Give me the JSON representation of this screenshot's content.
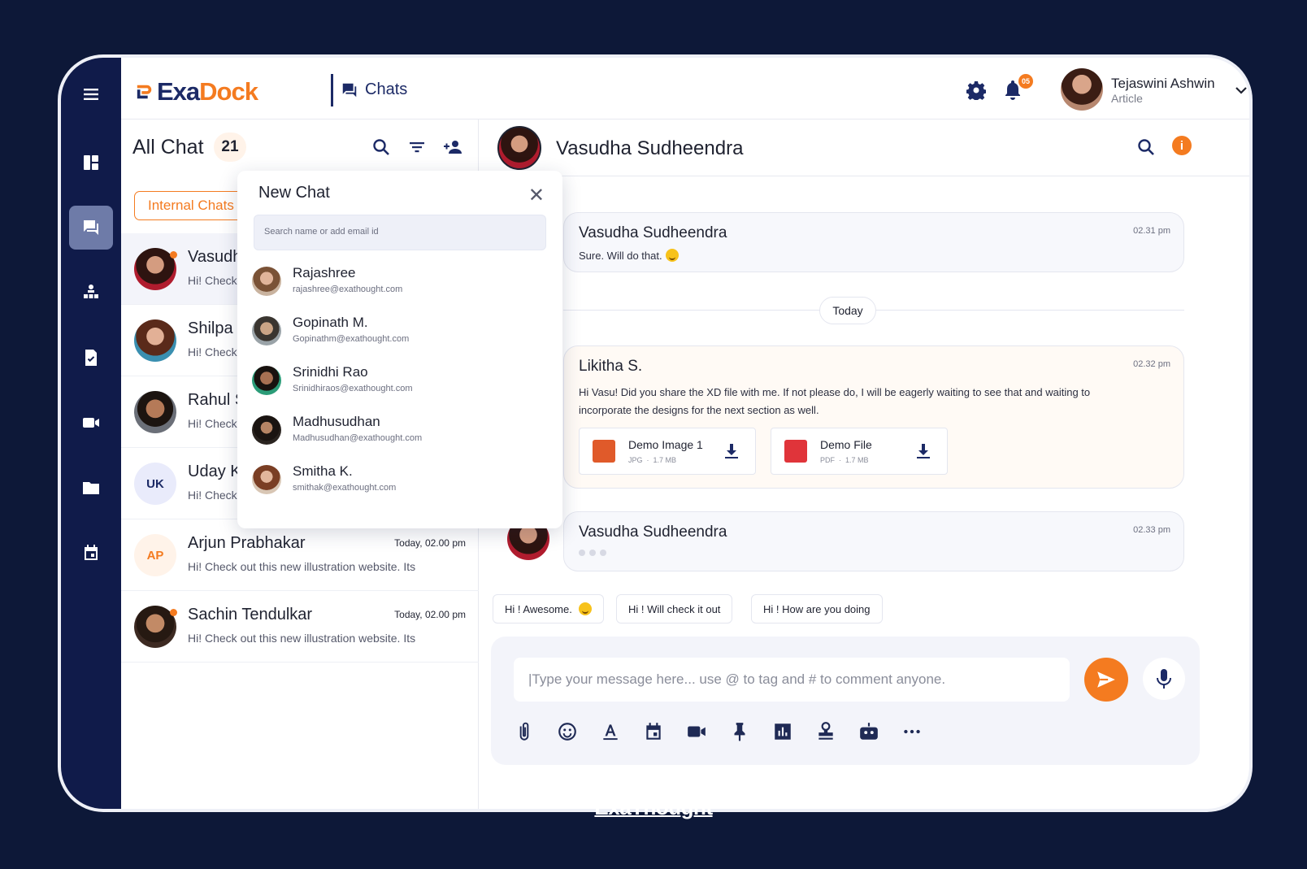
{
  "app": {
    "brand_left": "Exa",
    "brand_right": "Dock",
    "section": "Chats"
  },
  "notifications": {
    "count": "05"
  },
  "user": {
    "name": "Tejaswini Ashwin",
    "role": "Article"
  },
  "left": {
    "title": "All Chat",
    "count": "21",
    "tab_internal": "Internal Chats",
    "chats": [
      {
        "name": "Vasudha Sudheendra",
        "preview": "Hi! Check out this new illustration website. Its",
        "time": ""
      },
      {
        "name": "Shilpa Shetty",
        "preview": "Hi! Check out this new illustration website. Its",
        "time": ""
      },
      {
        "name": "Rahul Sharma",
        "preview": "Hi! Check out this new illustration website. Its",
        "time": ""
      },
      {
        "name": "Uday Kumar",
        "initials": "UK",
        "preview": "Hi! Check out this new illustration website. Its",
        "time": ""
      },
      {
        "name": "Arjun Prabhakar",
        "initials": "AP",
        "preview": "Hi! Check out this new illustration website. Its",
        "time": "Today, 02.00 pm"
      },
      {
        "name": "Sachin Tendulkar",
        "preview": "Hi! Check out this new illustration website. Its",
        "time": "Today, 02.00 pm"
      }
    ]
  },
  "new_chat": {
    "title": "New Chat",
    "search_placeholder": "Search name or add email id",
    "contacts": [
      {
        "name": "Rajashree",
        "email": "rajashree@exathought.com"
      },
      {
        "name": "Gopinath M.",
        "email": "Gopinathm@exathought.com"
      },
      {
        "name": "Srinidhi Rao",
        "email": "Srinidhiraos@exathought.com"
      },
      {
        "name": "Madhusudhan",
        "email": "Madhusudhan@exathought.com"
      },
      {
        "name": "Smitha K.",
        "email": "smithak@exathought.com"
      }
    ]
  },
  "conversation": {
    "contact": "Vasudha Sudheendra",
    "messages": [
      {
        "sender": "Vasudha Sudheendra",
        "time": "02.31 pm",
        "text": "Sure. Will do that."
      },
      {
        "sender": "Likitha S.",
        "time": "02.32 pm",
        "text": "Hi Vasu! Did you share the XD file with me. If not please do, I will be eagerly waiting to see that and waiting to incorporate the designs for the next section as well."
      },
      {
        "sender": "Vasudha Sudheendra",
        "time": "02.33 pm",
        "text": ""
      }
    ],
    "day_separator": "Today",
    "attachments": [
      {
        "name": "Demo Image 1",
        "type": "JPG",
        "size": "1.7 MB"
      },
      {
        "name": "Demo File",
        "type": "PDF",
        "size": "1.7 MB"
      }
    ],
    "quick_replies": [
      "Hi ! Awesome.",
      "Hi ! Will check it out",
      "Hi ! How are you doing"
    ]
  },
  "composer": {
    "placeholder": "|Type your message here... use @ to tag and # to comment anyone.",
    "tools": [
      "attach-icon",
      "emoji-icon",
      "text-format-icon",
      "calendar-icon",
      "video-icon",
      "pin-icon",
      "poll-icon",
      "stamp-icon",
      "bot-icon",
      "more-icon"
    ]
  },
  "footer": {
    "brand": "ExaThought"
  },
  "colors": {
    "accent": "#f47b20",
    "navy": "#101b4a",
    "background": "#0d1838"
  }
}
